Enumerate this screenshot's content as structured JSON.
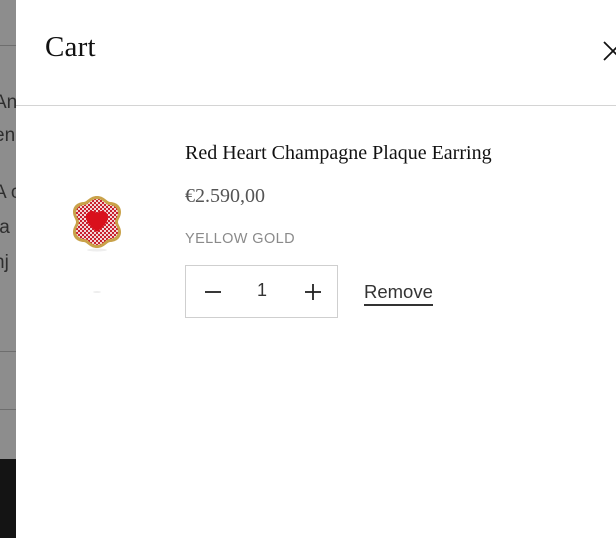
{
  "cart": {
    "title": "Cart",
    "close_icon": "close-icon"
  },
  "items": [
    {
      "name": "Red Heart Champagne Plaque Earring",
      "price": "€2.590,00",
      "variant": "YELLOW GOLD",
      "quantity": "1",
      "remove_label": "Remove",
      "image_icon": "heart-earring-image"
    }
  ],
  "quantity_controls": {
    "decrease_icon": "minus-icon",
    "increase_icon": "plus-icon"
  },
  "colors": {
    "overlay": "#8d8d8d",
    "drawer_background": "#ffffff",
    "text_primary": "#111111",
    "text_secondary": "#555555",
    "variant_text": "#8a8a8a",
    "earring_red": "#c8202e",
    "earring_gold": "#c9a24a"
  }
}
